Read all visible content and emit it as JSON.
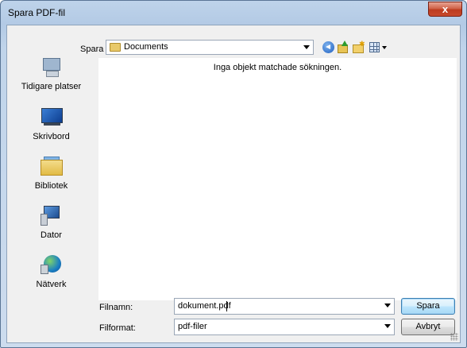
{
  "window": {
    "title": "Spara PDF-fil",
    "close_symbol": "x"
  },
  "toolbar": {
    "look_in_label": "Spara i:",
    "look_in_value": "Documents",
    "look_in_icon": "folder-icon",
    "buttons": [
      {
        "name": "back",
        "icon": "back-arrow-icon"
      },
      {
        "name": "up-folder",
        "icon": "up-folder-icon"
      },
      {
        "name": "new-folder",
        "icon": "new-folder-icon"
      },
      {
        "name": "view-menu",
        "icon": "view-menu-icon"
      }
    ]
  },
  "places": [
    {
      "label": "Tidigare platser",
      "icon": "recent-places-icon"
    },
    {
      "label": "Skrivbord",
      "icon": "desktop-icon"
    },
    {
      "label": "Bibliotek",
      "icon": "libraries-icon"
    },
    {
      "label": "Dator",
      "icon": "computer-icon"
    },
    {
      "label": "Nätverk",
      "icon": "network-icon"
    }
  ],
  "file_list": {
    "empty_message": "Inga objekt matchade sökningen."
  },
  "filename": {
    "label": "Filnamn:",
    "value": "dokument.pdf"
  },
  "filetype": {
    "label": "Filformat:",
    "value": "pdf-filer"
  },
  "actions": {
    "save_label": "Spara",
    "cancel_label": "Avbryt"
  },
  "colors": {
    "title_bar": "#b9cfe8",
    "close_button": "#c74a2c",
    "primary_button": "#bee6fd"
  }
}
